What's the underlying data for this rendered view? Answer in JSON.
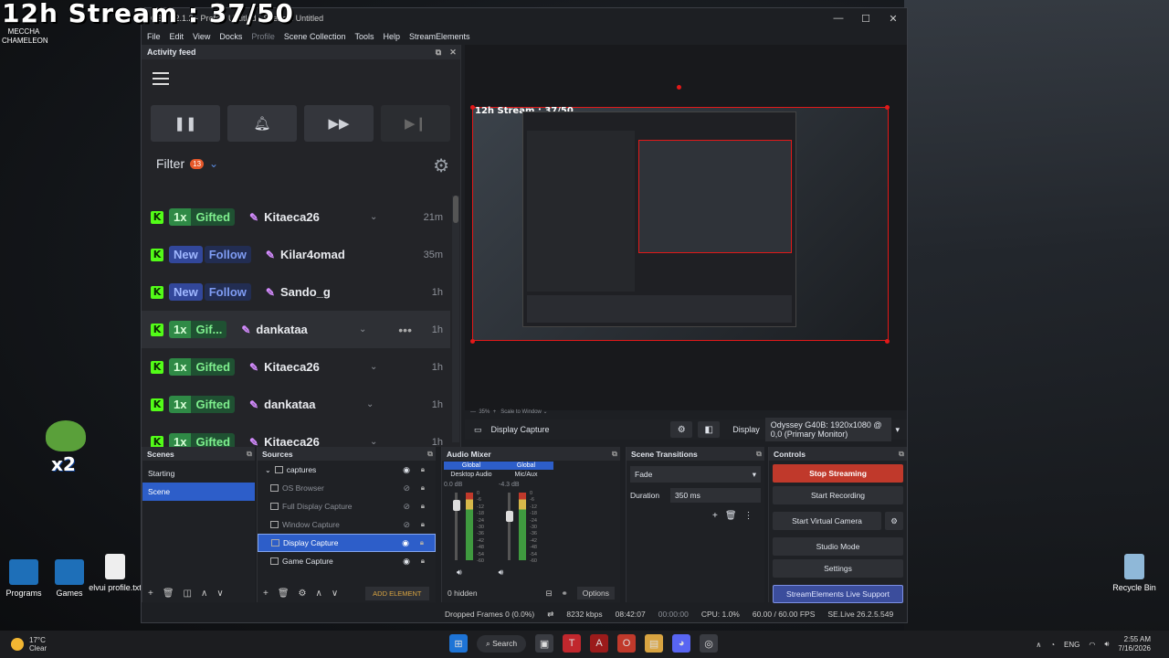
{
  "overlay": {
    "title": "12h Stream : 37/50"
  },
  "desktop": {
    "profile_name": "MECCHA CHAMELEON",
    "icons": [
      {
        "label": "Programs"
      },
      {
        "label": "Games"
      },
      {
        "label": "elvui profile.txt"
      },
      {
        "label": "Recycle Bin"
      }
    ],
    "pepe_badge": "x2"
  },
  "obs": {
    "title": "OBS 32.1.2 - Profile: Untitled - Scenes: Untitled",
    "menu": [
      "File",
      "Edit",
      "View",
      "Docks",
      "Profile",
      "Scene Collection",
      "Tools",
      "Help",
      "StreamElements"
    ],
    "activity_feed": {
      "title": "Activity feed",
      "filter_label": "Filter",
      "filter_count": "13",
      "events": [
        {
          "qty": "1x",
          "type": "Gifted",
          "user": "Kitaeca26",
          "time": "21m"
        },
        {
          "qty": "New",
          "type": "Follow",
          "user": "Kilar4omad",
          "time": "35m"
        },
        {
          "qty": "New",
          "type": "Follow",
          "user": "Sando_g",
          "time": "1h"
        },
        {
          "qty": "1x",
          "type": "Gif...",
          "user": "dankataa",
          "time": "1h"
        },
        {
          "qty": "1x",
          "type": "Gifted",
          "user": "Kitaeca26",
          "time": "1h"
        },
        {
          "qty": "1x",
          "type": "Gifted",
          "user": "dankataa",
          "time": "1h"
        },
        {
          "qty": "1x",
          "type": "Gifted",
          "user": "Kitaeca26",
          "time": "1h"
        }
      ]
    },
    "preview": {
      "mini_title": "12h Stream : 37/50",
      "zoom": "35%",
      "scale_label": "Scale to Window"
    },
    "source_bar": {
      "source": "Display Capture",
      "display_label": "Display",
      "display_value": "Odyssey G40B: 1920x1080 @ 0,0 (Primary Monitor)"
    },
    "scenes": {
      "title": "Scenes",
      "items": [
        "Starting",
        "Scene"
      ],
      "active": 1
    },
    "sources": {
      "title": "Sources",
      "group": "captures",
      "items": [
        {
          "name": "OS Browser"
        },
        {
          "name": "Full Display Capture"
        },
        {
          "name": "Window Capture"
        },
        {
          "name": "Display Capture"
        },
        {
          "name": "Game Capture"
        }
      ],
      "add_element": "ADD ELEMENT"
    },
    "audio_mixer": {
      "title": "Audio Mixer",
      "channels": [
        {
          "scope": "Global",
          "name": "Desktop Audio",
          "db": "0.0 dB"
        },
        {
          "scope": "Global",
          "name": "Mic/Aux",
          "db": "-4.3 dB"
        }
      ],
      "scale": [
        "0",
        "-6",
        "-12",
        "-18",
        "-24",
        "-30",
        "-36",
        "-42",
        "-48",
        "-54",
        "-60"
      ],
      "hidden": "0 hidden",
      "options": "Options"
    },
    "transitions": {
      "title": "Scene Transitions",
      "type": "Fade",
      "duration_label": "Duration",
      "duration_value": "350 ms"
    },
    "controls": {
      "title": "Controls",
      "stop_streaming": "Stop Streaming",
      "start_recording": "Start Recording",
      "start_virtual_camera": "Start Virtual Camera",
      "studio_mode": "Studio Mode",
      "settings": "Settings",
      "se_support": "StreamElements Live Support"
    },
    "status": {
      "dropped": "Dropped Frames 0 (0.0%)",
      "kbps": "8232 kbps",
      "stream_time": "08:42:07",
      "rec_time": "00:00:00",
      "cpu": "CPU: 1.0%",
      "fps": "60.00 / 60.00 FPS",
      "version": "SE.Live 26.2.5.549"
    }
  },
  "taskbar": {
    "weather_temp": "17°C",
    "weather_desc": "Clear",
    "search": "Search",
    "lang": "ENG",
    "time": "2:55 AM",
    "date": "7/16/2026"
  }
}
